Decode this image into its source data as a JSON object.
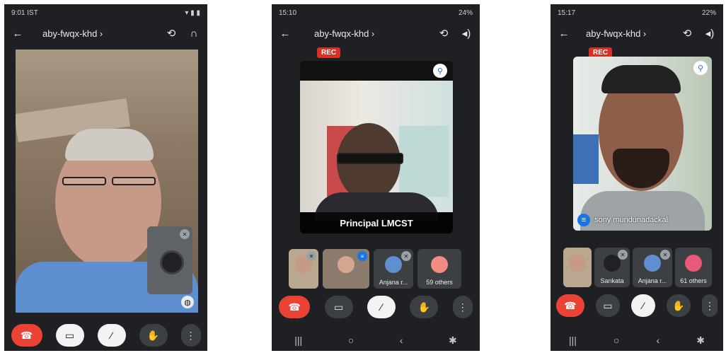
{
  "phones": [
    {
      "status_time": "9:01 IST",
      "meeting_code": "aby-fwqx-khd ›",
      "icons": {
        "back": "back-arrow-icon",
        "switch": "switch-camera-icon",
        "audio": "headphones-icon"
      }
    },
    {
      "status_time": "15:10",
      "status_right": "24%",
      "meeting_code": "aby-fwqx-khd ›",
      "rec_label": "REC",
      "main_name": "Principal LMCST",
      "thumbs": [
        "",
        "",
        "Anjana r...",
        "59 others"
      ]
    },
    {
      "status_time": "15:17",
      "status_right": "22%",
      "meeting_code": "aby-fwqx-khd ›",
      "rec_label": "REC",
      "main_name": "sony mundunadackal",
      "thumbs": [
        "",
        "Sankata",
        "Anjana r...",
        "61 others"
      ]
    }
  ],
  "colors": {
    "end_call": "#ea4335",
    "rec": "#d93025",
    "dark_bg": "#1f2023",
    "pin": "#1a73e8"
  }
}
